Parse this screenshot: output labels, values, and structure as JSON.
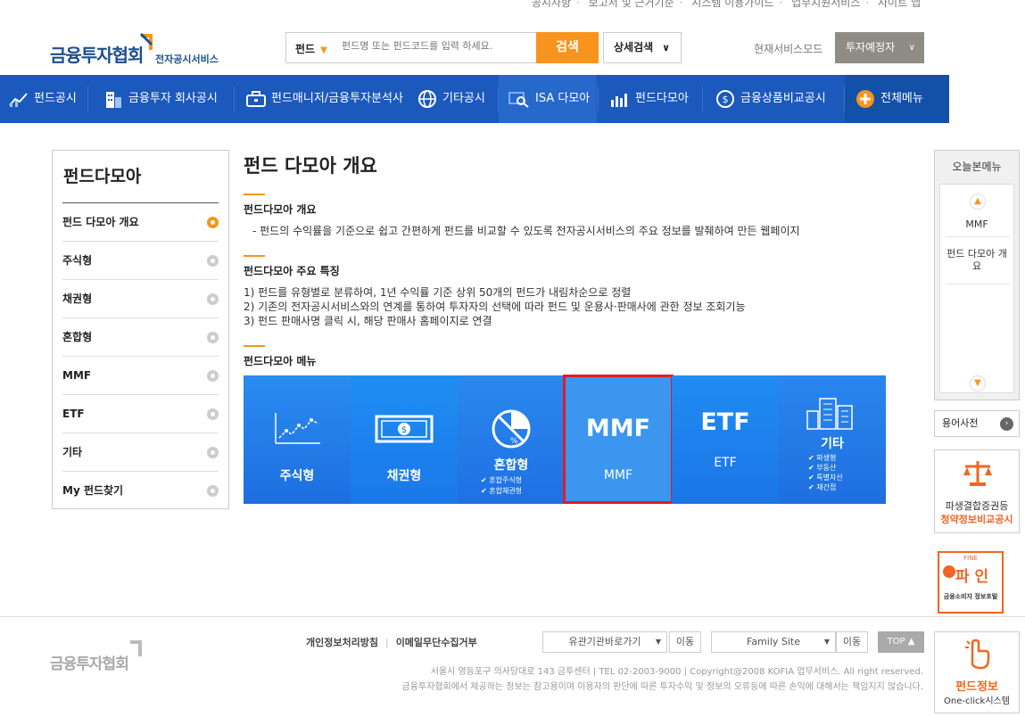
{
  "util_links": [
    "공시사항",
    "보고서 및 근거기준",
    "시스템 이용가이드",
    "업무지원서비스",
    "사이트 맵"
  ],
  "header": {
    "logo_main": "금융투자협회",
    "logo_sub": "전자공시서비스",
    "search_select": "펀드",
    "search_placeholder": "펀드명 또는 펀드코드를 입력 하세요.",
    "search_btn": "검색",
    "adv_btn": "상세검색",
    "mode_label": "현재서비스모드",
    "mode_value": "투자예정자"
  },
  "gnb": [
    "펀드공시",
    "금융투자 회사공시",
    "펀드매니저/금융투자분석사",
    "기타공시",
    "ISA 다모아",
    "펀드다모아",
    "금융상품비교공시",
    "전체메뉴"
  ],
  "lnb": {
    "title": "펀드다모아",
    "items": [
      "펀드 다모아 개요",
      "주식형",
      "채권형",
      "혼합형",
      "MMF",
      "ETF",
      "기타",
      "My 펀드찾기"
    ]
  },
  "content": {
    "title": "펀드 다모아 개요",
    "sec1_title": "펀드다모아 개요",
    "sec1_text": "- 펀드의 수익률을 기준으로 쉽고 간편하게 펀드를 비교할 수 있도록 전자공시서비스의 주요 정보를 발췌하여 만든 웹페이지",
    "sec2_title": "펀드다모아 주요 특징",
    "sec2_lines": [
      "1) 펀드를 유형별로 분류하여, 1년 수익률 기준 상위 50개의 펀드가 내림차순으로 정렬",
      "2) 기존의 전자공시서비스와의 연계를 통하여 투자자의 선택에 따라 펀드 및 운용사·판매사에 관한 정보 조회기능",
      "3) 펀드 판매사명 클릭 시, 해당 판매사 홈페이지로 연결"
    ],
    "sec3_title": "펀드다모아 메뉴"
  },
  "tiles": {
    "stock": "주식형",
    "bond": "채권형",
    "mixed": "혼합형",
    "mixed_sub1": "✔ 혼합주식형",
    "mixed_sub2": "✔ 혼합채권형",
    "mmf_big": "MMF",
    "mmf": "MMF",
    "etf_big": "ETF",
    "etf": "ETF",
    "etc": "기타",
    "etc_sub": [
      "✔ 파생형",
      "✔ 부동산",
      "✔ 특별자산",
      "✔ 재간접"
    ]
  },
  "quick": {
    "title": "오늘본메뉴",
    "items": [
      "MMF",
      "펀드 다모아 개요"
    ],
    "dict": "용어사전",
    "banner1_line1": "파생결합증권등",
    "banner1_line2": "청약정보비교공시",
    "banner2_top": "FINE",
    "banner2_main": "파 인",
    "banner2_sub": "금융소비자 정보포털",
    "banner3_line1": "펀드정보",
    "banner3_line2": "One-click시스템"
  },
  "footer": {
    "logo": "금융투자협회",
    "link1": "개인정보처리방침",
    "link2": "이메일무단수집거부",
    "select1": "유관기관바로가기",
    "select2": "Family Site",
    "move": "이동",
    "top": "TOP",
    "addr": "서울시 영등포구 의사당대로 143 금투센터 | TEL 02-2003-9000 | Copyright@2008 KOFIA 업무서비스. All right reserved.",
    "notice": "금융투자협회에서 제공하는 정보는 참고용이며 이용자의 판단에 따른 투자수익 및 정보의 오류등에 따른 손익에 대해서는 책임지지 않습니다."
  },
  "colors": {
    "brand_blue": "#1c59bc",
    "accent_orange": "#f7941d",
    "highlight_red": "#e21b22"
  }
}
